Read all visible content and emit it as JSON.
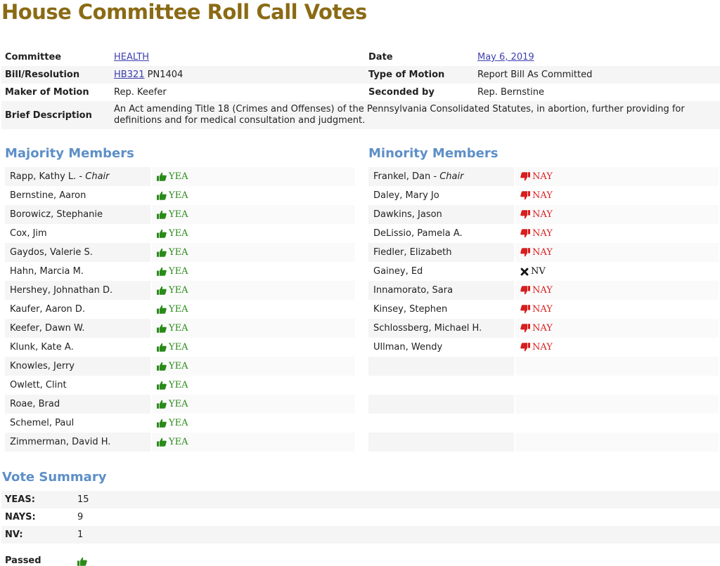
{
  "page": {
    "title": "House Committee Roll Call Votes"
  },
  "info": {
    "committee_label": "Committee",
    "committee": "HEALTH",
    "date_label": "Date",
    "date": "May 6, 2019",
    "bill_label": "Bill/Resolution",
    "bill_link": "HB321",
    "bill_pn": "PN1404",
    "motion_type_label": "Type of Motion",
    "motion_type": "Report Bill As Committed",
    "maker_label": "Maker of Motion",
    "maker": "Rep. Keefer",
    "seconded_label": "Seconded by",
    "seconded": "Rep. Bernstine",
    "description_label": "Brief Description",
    "description": "An Act amending Title 18 (Crimes and Offenses) of the Pennsylvania Consolidated Statutes, in abortion, further providing for definitions and for medical consultation and judgment."
  },
  "majority": {
    "title": "Majority Members",
    "members": [
      {
        "name": "Rapp, Kathy L.",
        "chair": " - Chair",
        "vote": "YEA"
      },
      {
        "name": "Bernstine, Aaron",
        "vote": "YEA"
      },
      {
        "name": "Borowicz, Stephanie",
        "vote": "YEA"
      },
      {
        "name": "Cox, Jim",
        "vote": "YEA"
      },
      {
        "name": "Gaydos, Valerie S.",
        "vote": "YEA"
      },
      {
        "name": "Hahn, Marcia M.",
        "vote": "YEA"
      },
      {
        "name": "Hershey, Johnathan D.",
        "vote": "YEA"
      },
      {
        "name": "Kaufer, Aaron D.",
        "vote": "YEA"
      },
      {
        "name": "Keefer, Dawn W.",
        "vote": "YEA"
      },
      {
        "name": "Klunk, Kate A.",
        "vote": "YEA"
      },
      {
        "name": "Knowles, Jerry",
        "vote": "YEA"
      },
      {
        "name": "Owlett, Clint",
        "vote": "YEA"
      },
      {
        "name": "Roae, Brad",
        "vote": "YEA"
      },
      {
        "name": "Schemel, Paul",
        "vote": "YEA"
      },
      {
        "name": "Zimmerman, David H.",
        "vote": "YEA"
      }
    ]
  },
  "minority": {
    "title": "Minority Members",
    "members": [
      {
        "name": "Frankel, Dan",
        "chair": " - Chair",
        "vote": "NAY"
      },
      {
        "name": "Daley, Mary Jo",
        "vote": "NAY"
      },
      {
        "name": "Dawkins, Jason",
        "vote": "NAY"
      },
      {
        "name": "DeLissio, Pamela A.",
        "vote": "NAY"
      },
      {
        "name": "Fiedler, Elizabeth",
        "vote": "NAY"
      },
      {
        "name": "Gainey, Ed",
        "vote": "NV"
      },
      {
        "name": "Innamorato, Sara",
        "vote": "NAY"
      },
      {
        "name": "Kinsey, Stephen",
        "vote": "NAY"
      },
      {
        "name": "Schlossberg, Michael H.",
        "vote": "NAY"
      },
      {
        "name": "Ullman, Wendy",
        "vote": "NAY"
      },
      {
        "name": "",
        "vote": ""
      },
      {
        "name": "",
        "vote": ""
      },
      {
        "name": "",
        "vote": ""
      },
      {
        "name": "",
        "vote": ""
      },
      {
        "name": "",
        "vote": ""
      }
    ]
  },
  "summary": {
    "title": "Vote Summary",
    "yeas_label": "YEAS:",
    "yeas": "15",
    "nays_label": "NAYS:",
    "nays": "9",
    "nv_label": "NV:",
    "nv": "1",
    "passed_label": "Passed",
    "passed_icon": "thumbs-up-icon"
  },
  "colors": {
    "title": "#8a6a14",
    "section": "#5d8fc7",
    "yea": "#2a8a1a",
    "nay": "#d81e1e",
    "link": "#3d3fb0"
  }
}
